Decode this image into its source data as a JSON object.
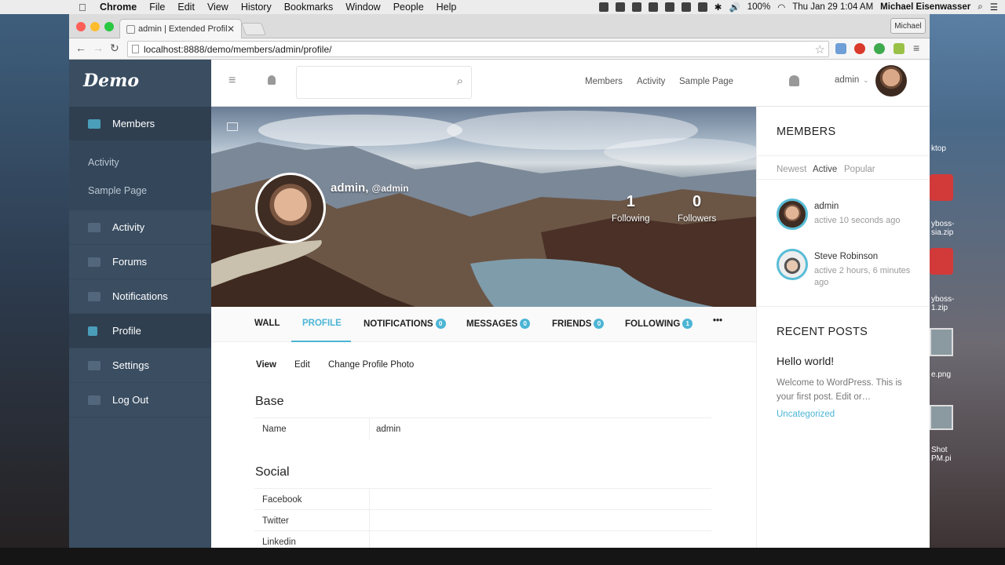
{
  "menubar": {
    "app": "Chrome",
    "items": [
      "File",
      "Edit",
      "View",
      "History",
      "Bookmarks",
      "Window",
      "People",
      "Help"
    ],
    "battery": "100%",
    "clock": "Thu Jan 29  1:04 AM",
    "user": "Michael Eisenwasser"
  },
  "desktop": {
    "labels": [
      "ktop",
      "yboss-\nsia.zip",
      "yboss-\n1.zip",
      "e.png",
      "Shot\nPM.pi"
    ]
  },
  "browser": {
    "tab_title": "admin | Extended Profiles",
    "profile_button": "Michael",
    "url": "localhost:8888/demo/members/admin/profile/"
  },
  "site": {
    "logo": "Demo",
    "sidebar": {
      "members": "Members",
      "sub": [
        "Activity",
        "Sample Page"
      ],
      "items": [
        {
          "label": "Activity",
          "icon": "quote-icon"
        },
        {
          "label": "Forums",
          "icon": "chat-icon"
        },
        {
          "label": "Notifications",
          "icon": "bell-icon"
        },
        {
          "label": "Profile",
          "icon": "user-icon"
        },
        {
          "label": "Settings",
          "icon": "gears-icon"
        },
        {
          "label": "Log Out",
          "icon": "logout-icon"
        }
      ]
    },
    "topnav": {
      "links": [
        "Members",
        "Activity",
        "Sample Page"
      ],
      "user": "admin"
    },
    "cover": {
      "name": "admin",
      "handle": "@admin",
      "following_count": "1",
      "following_label": "Following",
      "followers_count": "0",
      "followers_label": "Followers"
    },
    "profile_tabs": [
      {
        "label": "WALL"
      },
      {
        "label": "PROFILE"
      },
      {
        "label": "NOTIFICATIONS",
        "badge": "0"
      },
      {
        "label": "MESSAGES",
        "badge": "0"
      },
      {
        "label": "FRIENDS",
        "badge": "0"
      },
      {
        "label": "FOLLOWING",
        "badge": "1"
      },
      {
        "label": "•••"
      }
    ],
    "subnav": [
      "View",
      "Edit",
      "Change Profile Photo"
    ],
    "sections": {
      "base_title": "Base",
      "base_rows": [
        {
          "k": "Name",
          "v": "admin"
        }
      ],
      "social_title": "Social",
      "social_rows": [
        {
          "k": "Facebook",
          "v": ""
        },
        {
          "k": "Twitter",
          "v": ""
        },
        {
          "k": "Linkedin",
          "v": ""
        }
      ]
    },
    "members_widget": {
      "title": "MEMBERS",
      "filters": [
        "Newest",
        "Active",
        "Popular"
      ],
      "list": [
        {
          "name": "admin",
          "activity": "active 10 seconds ago"
        },
        {
          "name": "Steve Robinson",
          "activity": "active 2 hours, 6 minutes ago"
        }
      ]
    },
    "recent_posts": {
      "title": "RECENT POSTS",
      "post_title": "Hello world!",
      "excerpt": "Welcome to WordPress. This is your first post. Edit or…",
      "category": "Uncategorized"
    },
    "accent_color": "#4cb5d4",
    "sidebar_color": "#3a4d61"
  }
}
